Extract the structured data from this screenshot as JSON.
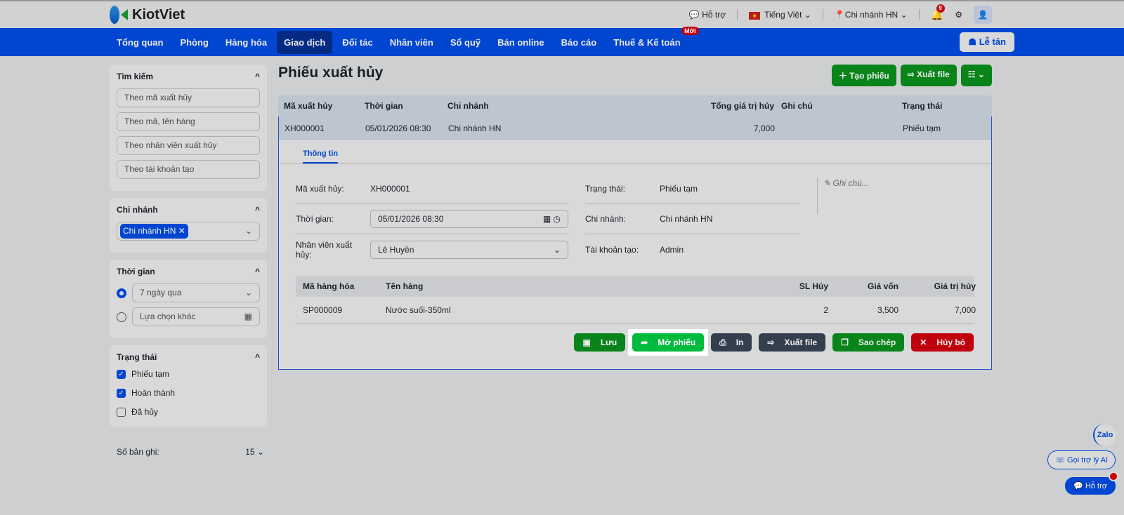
{
  "brand": "KiotViet",
  "top": {
    "help": "Hỗ trợ",
    "language": "Tiếng Việt",
    "branch": "Chi nhánh HN",
    "notifications": "9"
  },
  "nav": {
    "items": [
      "Tổng quan",
      "Phòng",
      "Hàng hóa",
      "Giao dịch",
      "Đối tác",
      "Nhân viên",
      "Sổ quỹ",
      "Bán online",
      "Báo cáo",
      "Thuế & Kế toán"
    ],
    "new_badge": "Mới",
    "reception": "Lễ tân"
  },
  "sidebar": {
    "search": {
      "title": "Tìm kiếm",
      "placeholders": [
        "Theo mã xuất hủy",
        "Theo mã, tên hàng",
        "Theo nhân viên xuất hủy",
        "Theo tài khoản tạo"
      ]
    },
    "branch": {
      "title": "Chi nhánh",
      "tag": "Chi nhánh HN"
    },
    "time": {
      "title": "Thời gian",
      "preset": "7 ngày qua",
      "custom": "Lựa chọn khác"
    },
    "status": {
      "title": "Trạng thái",
      "options": [
        {
          "label": "Phiếu tạm",
          "checked": true
        },
        {
          "label": "Hoàn thành",
          "checked": true
        },
        {
          "label": "Đã hủy",
          "checked": false
        }
      ]
    },
    "page_size_label": "Số bản ghi:",
    "page_size": "15"
  },
  "main": {
    "title": "Phiếu xuất hủy",
    "create": "Tạo phiếu",
    "export": "Xuất file",
    "columns": [
      "Mã xuất hủy",
      "Thời gian",
      "Chi nhánh",
      "Tổng giá trị hủy",
      "Ghi chú",
      "Trạng thái"
    ],
    "row": [
      "XH000001",
      "05/01/2026 08:30",
      "Chi nhánh HN",
      "7,000",
      "",
      "Phiếu tạm"
    ],
    "detail": {
      "tab": "Thông tin",
      "code_label": "Mã xuất hủy:",
      "code": "XH000001",
      "time_label": "Thời gian:",
      "time": "05/01/2026 08:30",
      "staff_label": "Nhân viên xuất hủy:",
      "staff": "Lê Huyền",
      "status_label": "Trạng thái:",
      "status": "Phiếu tạm",
      "branch_label": "Chi nhánh:",
      "branch": "Chi nhánh HN",
      "creator_label": "Tài khoản tạo:",
      "creator": "Admin",
      "note_placeholder": "Ghi chú...",
      "product_columns": [
        "Mã hàng hóa",
        "Tên hàng",
        "SL Hủy",
        "Giá vốn",
        "Giá trị hủy"
      ],
      "products": [
        [
          "SP000009",
          "Nước suối-350ml",
          "2",
          "3,500",
          "7,000"
        ]
      ],
      "actions": {
        "save": "Lưu",
        "open": "Mở phiếu",
        "print": "In",
        "export": "Xuất file",
        "copy": "Sao chép",
        "cancel": "Hủy bỏ"
      }
    }
  },
  "floating": {
    "zalo": "Zalo",
    "ai": "Gọi trợ lý AI",
    "support": "Hỗ trợ"
  }
}
